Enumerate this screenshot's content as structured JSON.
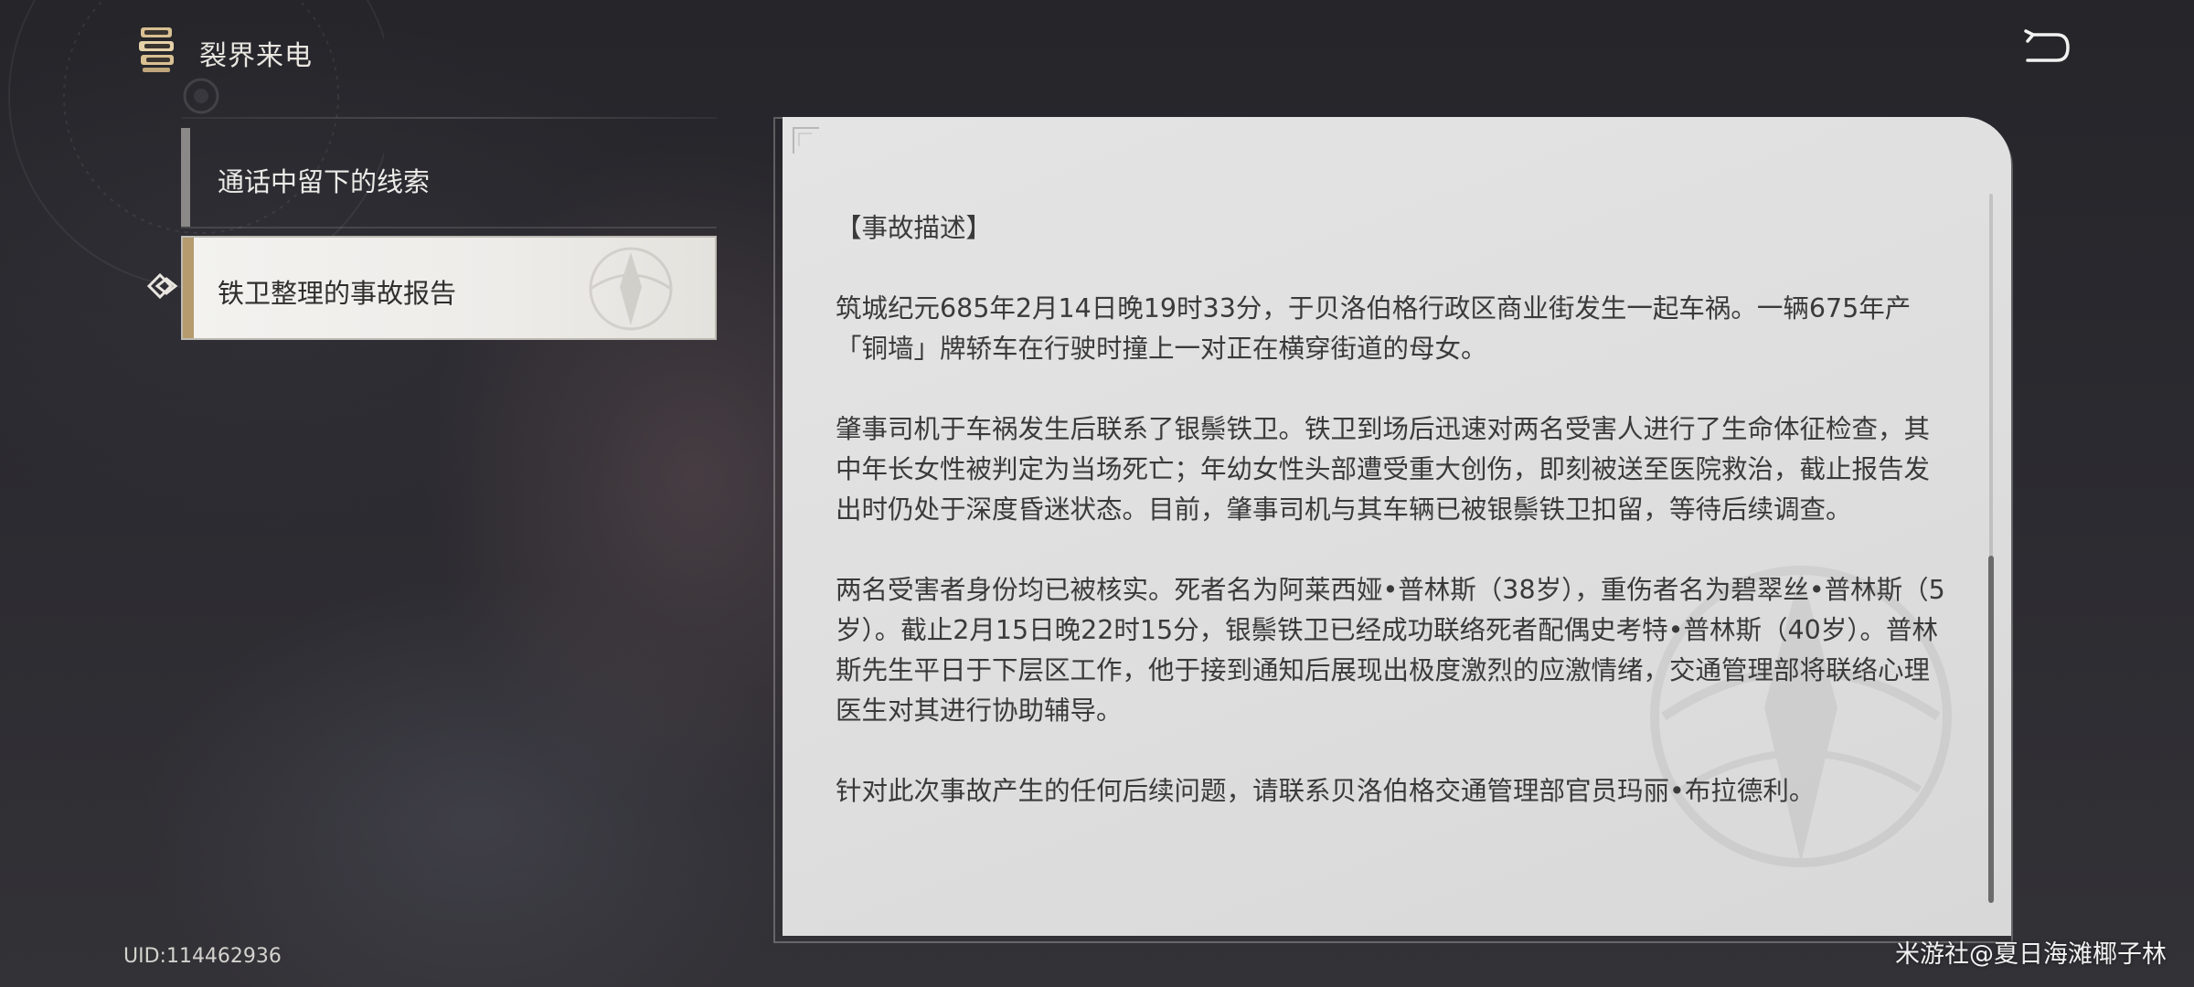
{
  "header": {
    "title": "裂界来电",
    "icon": "book-stack-icon",
    "back_icon": "return-arrow-icon"
  },
  "sidebar": {
    "items": [
      {
        "label": "通话中留下的线索",
        "selected": false
      },
      {
        "label": "铁卫整理的事故报告",
        "selected": true
      }
    ],
    "selector_icon": "diamond-pointer-icon"
  },
  "report": {
    "heading": "【事故描述】",
    "paragraphs": [
      "筑城纪元685年2月14日晚19时33分，于贝洛伯格行政区商业街发生一起车祸。一辆675年产「铜墙」牌轿车在行驶时撞上一对正在横穿街道的母女。",
      "肇事司机于车祸发生后联系了银鬃铁卫。铁卫到场后迅速对两名受害人进行了生命体征检查，其中年长女性被判定为当场死亡；年幼女性头部遭受重大创伤，即刻被送至医院救治，截止报告发出时仍处于深度昏迷状态。目前，肇事司机与其车辆已被银鬃铁卫扣留，等待后续调查。",
      "两名受害者身份均已被核实。死者名为阿莱西娅•普林斯（38岁），重伤者名为碧翠丝•普林斯（5岁）。截止2月15日晚22时15分，银鬃铁卫已经成功联络死者配偶史考特•普林斯（40岁）。普林斯先生平日于下层区工作，他于接到通知后展现出极度激烈的应激情绪，交通管理部将联络心理医生对其进行协助辅导。",
      "针对此次事故产生的任何后续问题，请联系贝洛伯格交通管理部官员玛丽•布拉德利。"
    ],
    "scroll_position": 0.55
  },
  "footer": {
    "uid": "UID:114462936",
    "credit": "米游社@夏日海滩椰子林"
  },
  "colors": {
    "accent_gold": "#b59b6d",
    "panel_bg": "#dedede",
    "text_dark": "#3a3a3b"
  }
}
